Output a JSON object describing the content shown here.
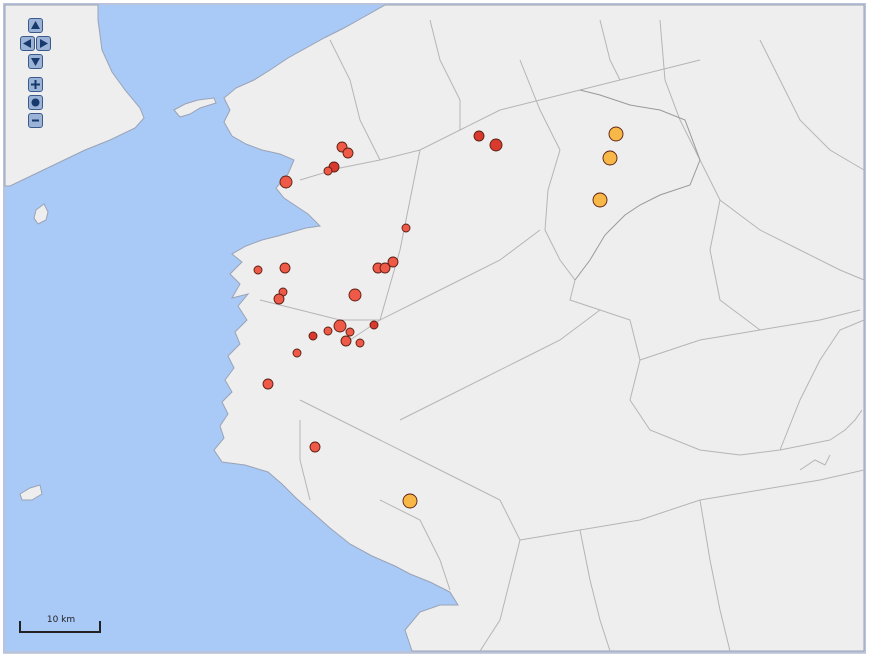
{
  "map": {
    "sea_color": "#a9c9f7",
    "land_color": "#eeeeee",
    "border_color": "#b5b5b5",
    "coast_color": "#9aa3b5",
    "scale_label": "10 km",
    "controls": [
      {
        "name": "pan-up-button",
        "icon": "arrow-up-icon"
      },
      {
        "name": "pan-left-button",
        "icon": "arrow-left-icon"
      },
      {
        "name": "pan-right-button",
        "icon": "arrow-right-icon"
      },
      {
        "name": "pan-down-button",
        "icon": "arrow-down-icon"
      },
      {
        "name": "zoom-in-button",
        "icon": "plus-icon"
      },
      {
        "name": "zoom-reset-button",
        "icon": "dot-icon"
      },
      {
        "name": "zoom-out-button",
        "icon": "minus-icon"
      }
    ],
    "marker_colors": {
      "red": "#ee5a47",
      "darkred": "#d83a2e",
      "orange": "#f7b847"
    }
  }
}
